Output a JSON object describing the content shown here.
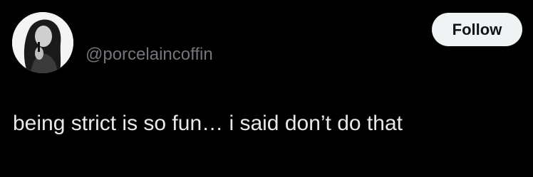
{
  "tweet": {
    "avatar_icon": "avatar-photo",
    "handle": "@porcelaincoffin",
    "follow_label": "Follow",
    "text": "being strict is so fun… i said don’t do that"
  },
  "colors": {
    "background": "#000000",
    "text": "#e7e9ea",
    "handle": "#72767b",
    "button_bg": "#eff3f4",
    "button_text": "#0f1419"
  }
}
